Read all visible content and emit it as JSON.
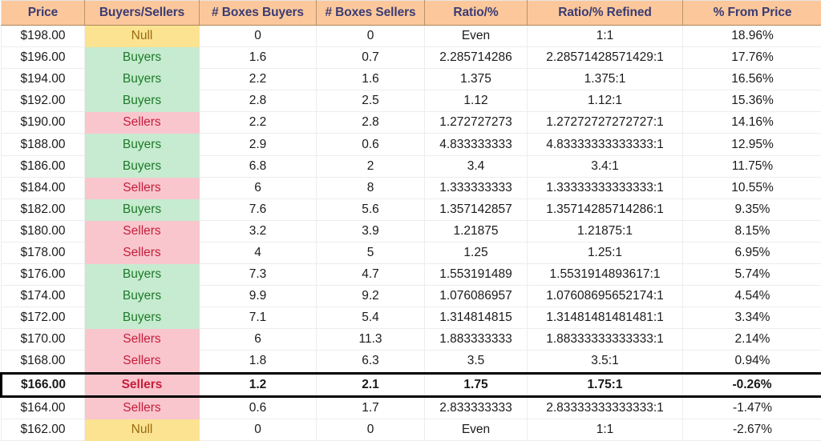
{
  "table": {
    "columns": [
      {
        "key": "price",
        "label": "Price"
      },
      {
        "key": "signal",
        "label": "Buyers/Sellers"
      },
      {
        "key": "boxes_buy",
        "label": "# Boxes Buyers"
      },
      {
        "key": "boxes_sell",
        "label": "# Boxes Sellers"
      },
      {
        "key": "ratio",
        "label": "Ratio/%"
      },
      {
        "key": "ratio_ref",
        "label": "Ratio/% Refined"
      },
      {
        "key": "from_price",
        "label": "% From Price"
      }
    ],
    "colors": {
      "header_bg": "#FCC89B",
      "header_text": "#3B3B74",
      "buyers_bg": "#C6EBD0",
      "buyers_text": "#1E7A29",
      "sellers_bg": "#F9C6CE",
      "sellers_text": "#C41E3A",
      "null_bg": "#FBE392",
      "null_text": "#9A6A10",
      "highlight_border": "#000000",
      "grid_line": "#EDEDED"
    },
    "rows": [
      {
        "price": "$198.00",
        "signal": "Null",
        "boxes_buy": "0",
        "boxes_sell": "0",
        "ratio": "Even",
        "ratio_ref": "1:1",
        "from_price": "18.96%",
        "highlight": false
      },
      {
        "price": "$196.00",
        "signal": "Buyers",
        "boxes_buy": "1.6",
        "boxes_sell": "0.7",
        "ratio": "2.285714286",
        "ratio_ref": "2.28571428571429:1",
        "from_price": "17.76%",
        "highlight": false
      },
      {
        "price": "$194.00",
        "signal": "Buyers",
        "boxes_buy": "2.2",
        "boxes_sell": "1.6",
        "ratio": "1.375",
        "ratio_ref": "1.375:1",
        "from_price": "16.56%",
        "highlight": false
      },
      {
        "price": "$192.00",
        "signal": "Buyers",
        "boxes_buy": "2.8",
        "boxes_sell": "2.5",
        "ratio": "1.12",
        "ratio_ref": "1.12:1",
        "from_price": "15.36%",
        "highlight": false
      },
      {
        "price": "$190.00",
        "signal": "Sellers",
        "boxes_buy": "2.2",
        "boxes_sell": "2.8",
        "ratio": "1.272727273",
        "ratio_ref": "1.27272727272727:1",
        "from_price": "14.16%",
        "highlight": false
      },
      {
        "price": "$188.00",
        "signal": "Buyers",
        "boxes_buy": "2.9",
        "boxes_sell": "0.6",
        "ratio": "4.833333333",
        "ratio_ref": "4.83333333333333:1",
        "from_price": "12.95%",
        "highlight": false
      },
      {
        "price": "$186.00",
        "signal": "Buyers",
        "boxes_buy": "6.8",
        "boxes_sell": "2",
        "ratio": "3.4",
        "ratio_ref": "3.4:1",
        "from_price": "11.75%",
        "highlight": false
      },
      {
        "price": "$184.00",
        "signal": "Sellers",
        "boxes_buy": "6",
        "boxes_sell": "8",
        "ratio": "1.333333333",
        "ratio_ref": "1.33333333333333:1",
        "from_price": "10.55%",
        "highlight": false
      },
      {
        "price": "$182.00",
        "signal": "Buyers",
        "boxes_buy": "7.6",
        "boxes_sell": "5.6",
        "ratio": "1.357142857",
        "ratio_ref": "1.35714285714286:1",
        "from_price": "9.35%",
        "highlight": false
      },
      {
        "price": "$180.00",
        "signal": "Sellers",
        "boxes_buy": "3.2",
        "boxes_sell": "3.9",
        "ratio": "1.21875",
        "ratio_ref": "1.21875:1",
        "from_price": "8.15%",
        "highlight": false
      },
      {
        "price": "$178.00",
        "signal": "Sellers",
        "boxes_buy": "4",
        "boxes_sell": "5",
        "ratio": "1.25",
        "ratio_ref": "1.25:1",
        "from_price": "6.95%",
        "highlight": false
      },
      {
        "price": "$176.00",
        "signal": "Buyers",
        "boxes_buy": "7.3",
        "boxes_sell": "4.7",
        "ratio": "1.553191489",
        "ratio_ref": "1.5531914893617:1",
        "from_price": "5.74%",
        "highlight": false
      },
      {
        "price": "$174.00",
        "signal": "Buyers",
        "boxes_buy": "9.9",
        "boxes_sell": "9.2",
        "ratio": "1.076086957",
        "ratio_ref": "1.07608695652174:1",
        "from_price": "4.54%",
        "highlight": false
      },
      {
        "price": "$172.00",
        "signal": "Buyers",
        "boxes_buy": "7.1",
        "boxes_sell": "5.4",
        "ratio": "1.314814815",
        "ratio_ref": "1.31481481481481:1",
        "from_price": "3.34%",
        "highlight": false
      },
      {
        "price": "$170.00",
        "signal": "Sellers",
        "boxes_buy": "6",
        "boxes_sell": "11.3",
        "ratio": "1.883333333",
        "ratio_ref": "1.88333333333333:1",
        "from_price": "2.14%",
        "highlight": false
      },
      {
        "price": "$168.00",
        "signal": "Sellers",
        "boxes_buy": "1.8",
        "boxes_sell": "6.3",
        "ratio": "3.5",
        "ratio_ref": "3.5:1",
        "from_price": "0.94%",
        "highlight": false
      },
      {
        "price": "$166.00",
        "signal": "Sellers",
        "boxes_buy": "1.2",
        "boxes_sell": "2.1",
        "ratio": "1.75",
        "ratio_ref": "1.75:1",
        "from_price": "-0.26%",
        "highlight": true
      },
      {
        "price": "$164.00",
        "signal": "Sellers",
        "boxes_buy": "0.6",
        "boxes_sell": "1.7",
        "ratio": "2.833333333",
        "ratio_ref": "2.83333333333333:1",
        "from_price": "-1.47%",
        "highlight": false
      },
      {
        "price": "$162.00",
        "signal": "Null",
        "boxes_buy": "0",
        "boxes_sell": "0",
        "ratio": "Even",
        "ratio_ref": "1:1",
        "from_price": "-2.67%",
        "highlight": false
      }
    ]
  }
}
